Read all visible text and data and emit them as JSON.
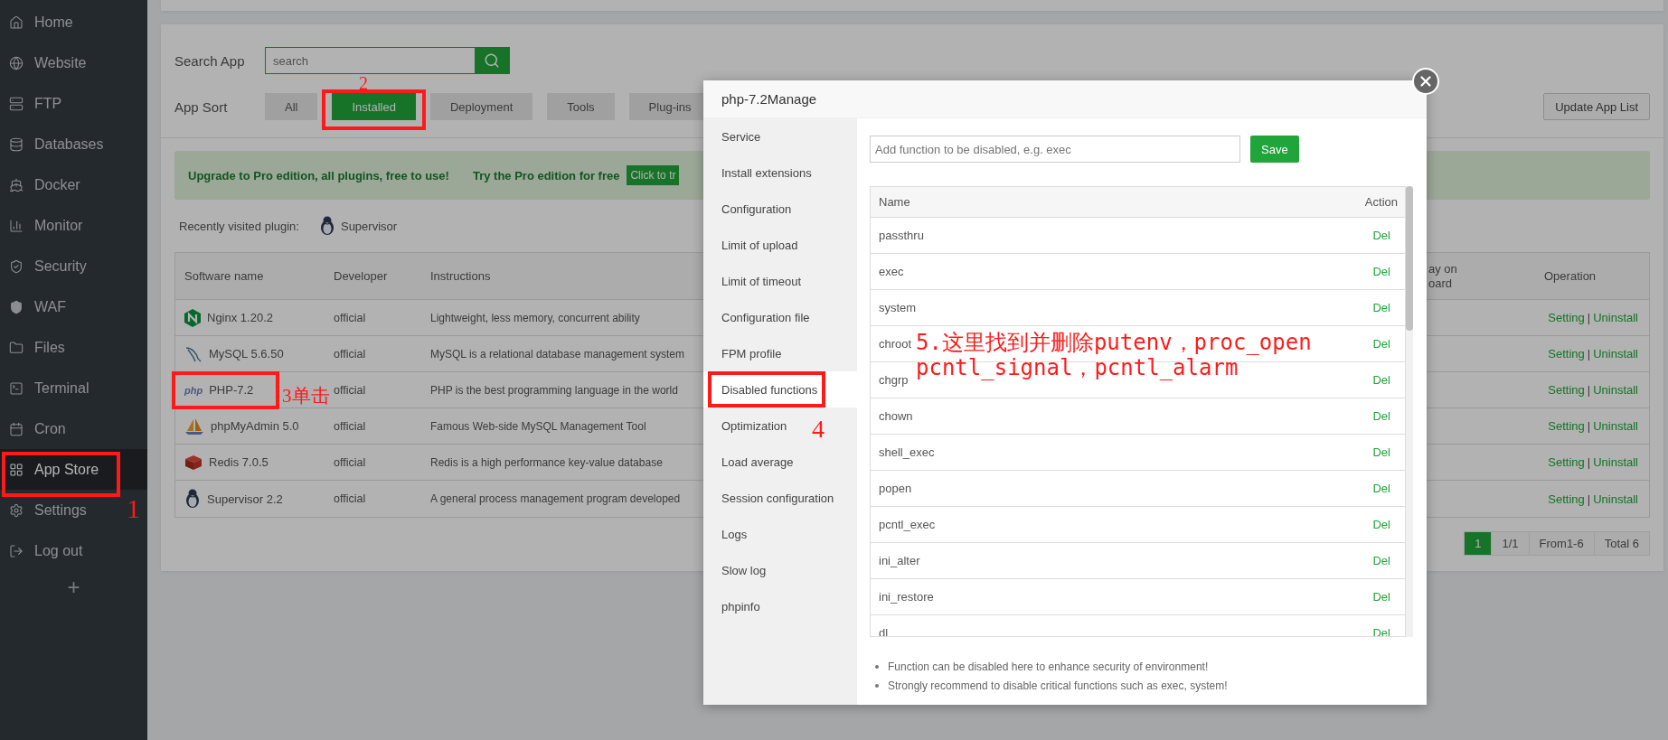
{
  "sidebar": {
    "items": [
      {
        "label": "Home",
        "selected": false,
        "highlighted": false
      },
      {
        "label": "Website",
        "selected": false,
        "highlighted": false
      },
      {
        "label": "FTP",
        "selected": false,
        "highlighted": false
      },
      {
        "label": "Databases",
        "selected": false,
        "highlighted": false
      },
      {
        "label": "Docker",
        "selected": false,
        "highlighted": false
      },
      {
        "label": "Monitor",
        "selected": false,
        "highlighted": false
      },
      {
        "label": "Security",
        "selected": false,
        "highlighted": false
      },
      {
        "label": "WAF",
        "selected": false,
        "highlighted": false
      },
      {
        "label": "Files",
        "selected": false,
        "highlighted": false
      },
      {
        "label": "Terminal",
        "selected": false,
        "highlighted": false
      },
      {
        "label": "Cron",
        "selected": false,
        "highlighted": false
      },
      {
        "label": "App Store",
        "selected": true,
        "highlighted": true
      },
      {
        "label": "Settings",
        "selected": false,
        "highlighted": false
      },
      {
        "label": "Log out",
        "selected": false,
        "highlighted": false
      }
    ],
    "add_button": "+"
  },
  "search": {
    "label": "Search App",
    "placeholder": "search"
  },
  "app_sort": {
    "label": "App Sort",
    "options": [
      {
        "label": "All",
        "selected": false,
        "highlighted": false
      },
      {
        "label": "Installed",
        "selected": true,
        "highlighted": true
      },
      {
        "label": "Deployment",
        "selected": false,
        "highlighted": false
      },
      {
        "label": "Tools",
        "selected": false,
        "highlighted": false
      },
      {
        "label": "Plug-ins",
        "selected": false,
        "highlighted": false
      }
    ]
  },
  "update_button": "Update App List",
  "banner": {
    "message": "Upgrade to Pro edition, all plugins, free to use!",
    "trial": "Try the Pro edition for free",
    "button": "Click to tr"
  },
  "recent": {
    "label": "Recently visited plugin:",
    "plugins": [
      {
        "name": "Supervisor"
      }
    ]
  },
  "table": {
    "columns": [
      "Software name",
      "Developer",
      "Instructions",
      "ay on\noard",
      "Operation"
    ],
    "rows": [
      {
        "name": "Nginx 1.20.2",
        "developer": "official",
        "instructions": "Lightweight, less memory, concurrent ability",
        "setting": "Setting",
        "separator": "|",
        "uninstall": "Uninstall",
        "highlighted": false
      },
      {
        "name": "MySQL 5.6.50",
        "developer": "official",
        "instructions": "MySQL is a relational database management system",
        "setting": "Setting",
        "separator": "|",
        "uninstall": "Uninstall",
        "highlighted": false
      },
      {
        "logo_text": "php",
        "name": "PHP-7.2",
        "developer": "official",
        "instructions": "PHP is the best programming language in the world",
        "setting": "Setting",
        "separator": "|",
        "uninstall": "Uninstall",
        "highlighted": true
      },
      {
        "name": "phpMyAdmin 5.0",
        "developer": "official",
        "instructions": "Famous Web-side MySQL Management Tool",
        "setting": "Setting",
        "separator": "|",
        "uninstall": "Uninstall",
        "highlighted": false
      },
      {
        "name": "Redis 7.0.5",
        "developer": "official",
        "instructions": "Redis is a high performance key-value database",
        "setting": "Setting",
        "separator": "|",
        "uninstall": "Uninstall",
        "highlighted": false
      },
      {
        "name": "Supervisor 2.2",
        "developer": "official",
        "instructions": "A general process management program developed",
        "setting": "Setting",
        "separator": "|",
        "uninstall": "Uninstall",
        "highlighted": false
      }
    ]
  },
  "pagination": {
    "pages": [
      {
        "label": "1",
        "selected": true
      }
    ],
    "page_count": "1/1",
    "range": "From1-6",
    "total": "Total 6"
  },
  "modal": {
    "title": "php-7.2Manage",
    "nav": [
      {
        "label": "Service",
        "selected": false,
        "highlighted": false
      },
      {
        "label": "Install extensions",
        "selected": false,
        "highlighted": false
      },
      {
        "label": "Configuration",
        "selected": false,
        "highlighted": false
      },
      {
        "label": "Limit of upload",
        "selected": false,
        "highlighted": false
      },
      {
        "label": "Limit of timeout",
        "selected": false,
        "highlighted": false
      },
      {
        "label": "Configuration file",
        "selected": false,
        "highlighted": false
      },
      {
        "label": "FPM profile",
        "selected": false,
        "highlighted": false
      },
      {
        "label": "Disabled functions",
        "selected": true,
        "highlighted": true
      },
      {
        "label": "Optimization",
        "selected": false,
        "highlighted": false
      },
      {
        "label": "Load average",
        "selected": false,
        "highlighted": false
      },
      {
        "label": "Session configuration",
        "selected": false,
        "highlighted": false
      },
      {
        "label": "Logs",
        "selected": false,
        "highlighted": false
      },
      {
        "label": "Slow log",
        "selected": false,
        "highlighted": false
      },
      {
        "label": "phpinfo",
        "selected": false,
        "highlighted": false
      }
    ],
    "input_placeholder": "Add function to be disabled, e.g. exec",
    "save": "Save",
    "table": {
      "columns": [
        "Name",
        "Action"
      ],
      "rows": [
        {
          "name": "passthru",
          "action": "Del"
        },
        {
          "name": "exec",
          "action": "Del"
        },
        {
          "name": "system",
          "action": "Del"
        },
        {
          "name": "chroot",
          "action": "Del"
        },
        {
          "name": "chgrp",
          "action": "Del"
        },
        {
          "name": "chown",
          "action": "Del"
        },
        {
          "name": "shell_exec",
          "action": "Del"
        },
        {
          "name": "popen",
          "action": "Del"
        },
        {
          "name": "pcntl_exec",
          "action": "Del"
        },
        {
          "name": "ini_alter",
          "action": "Del"
        },
        {
          "name": "ini_restore",
          "action": "Del"
        },
        {
          "name": "dl",
          "action": "Del"
        }
      ]
    },
    "notes": [
      "Function can be disabled here to enhance security of environment!",
      "Strongly recommend to disable critical functions such as exec, system!"
    ]
  },
  "annotations": [
    {
      "text": "1"
    },
    {
      "text": "2"
    },
    {
      "text": "3单击"
    },
    {
      "text": "4"
    },
    {
      "text": "5.这里找到并删除putenv，proc_open\npcntl_signal，pcntl_alarm"
    }
  ]
}
